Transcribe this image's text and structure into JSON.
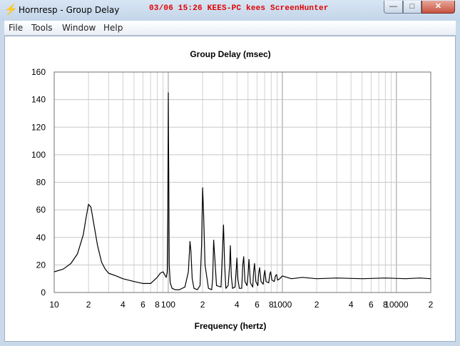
{
  "window": {
    "title": "Hornresp - Group Delay",
    "watermark": "03/06  15:26  KEES-PC  kees  ScreenHunter",
    "app_icon": "lightning-bolt-icon",
    "controls": {
      "minimize": "—",
      "maximize": "□",
      "close": "✕"
    }
  },
  "menu": [
    "File",
    "Tools",
    "Window",
    "Help"
  ],
  "chart_data": {
    "type": "line",
    "title": "Group Delay (msec)",
    "xlabel": "Frequency (hertz)",
    "ylabel": "",
    "xscale": "log",
    "xlim": [
      10,
      20000
    ],
    "ylim": [
      0,
      160
    ],
    "yticks": [
      0,
      20,
      40,
      60,
      80,
      100,
      120,
      140,
      160
    ],
    "xtick_labels": [
      {
        "x": 10,
        "label": "10"
      },
      {
        "x": 20,
        "label": "2"
      },
      {
        "x": 40,
        "label": "4"
      },
      {
        "x": 60,
        "label": "6"
      },
      {
        "x": 80,
        "label": "8"
      },
      {
        "x": 100,
        "label": "100"
      },
      {
        "x": 200,
        "label": "2"
      },
      {
        "x": 400,
        "label": "4"
      },
      {
        "x": 600,
        "label": "6"
      },
      {
        "x": 800,
        "label": "8"
      },
      {
        "x": 1000,
        "label": "1000"
      },
      {
        "x": 2000,
        "label": "2"
      },
      {
        "x": 4000,
        "label": "4"
      },
      {
        "x": 6000,
        "label": "6"
      },
      {
        "x": 8000,
        "label": "8"
      },
      {
        "x": 10000,
        "label": "10000"
      },
      {
        "x": 20000,
        "label": "2"
      }
    ],
    "grid": true,
    "series": [
      {
        "name": "",
        "color": "#000000",
        "x": [
          10,
          12,
          14,
          16,
          18,
          19,
          20,
          21,
          22,
          24,
          26,
          28,
          30,
          35,
          40,
          50,
          60,
          70,
          80,
          85,
          90,
          93,
          96,
          98,
          99,
          100,
          100.5,
          101,
          101.5,
          102,
          104,
          108,
          115,
          125,
          140,
          150,
          155,
          158,
          162,
          168,
          180,
          190,
          196,
          200,
          204,
          210,
          225,
          240,
          245,
          250,
          256,
          265,
          290,
          300,
          305,
          312,
          320,
          335,
          345,
          350,
          357,
          366,
          385,
          395,
          400,
          407,
          420,
          440,
          450,
          458,
          470,
          490,
          500,
          510,
          525,
          550,
          560,
          570,
          585,
          610,
          620,
          632,
          650,
          680,
          690,
          702,
          720,
          760,
          775,
          790,
          810,
          850,
          870,
          890,
          910,
          950,
          1000,
          1200,
          1500,
          2000,
          3000,
          5000,
          8000,
          12000,
          16000,
          20000
        ],
        "y": [
          15,
          17,
          21,
          28,
          42,
          54,
          64,
          62,
          52,
          34,
          22,
          17,
          14,
          12,
          10,
          8,
          6.5,
          6.5,
          11,
          14,
          15,
          13,
          11,
          15,
          60,
          145,
          110,
          90,
          48,
          20,
          7,
          3,
          2,
          2,
          4,
          15,
          37,
          30,
          10,
          3,
          2,
          5,
          35,
          76,
          57,
          20,
          3,
          2,
          10,
          38,
          25,
          5,
          4,
          35,
          49,
          20,
          3,
          5,
          20,
          34,
          12,
          3,
          4,
          18,
          25,
          10,
          3,
          3,
          20,
          26,
          8,
          5,
          13,
          24,
          7,
          4,
          15,
          21,
          8,
          5,
          14,
          18,
          8,
          6,
          12,
          16,
          8,
          7,
          13,
          15,
          9,
          8,
          12,
          13,
          9,
          10,
          12,
          10,
          11,
          10,
          10.5,
          10,
          10.5,
          10,
          10.5,
          10
        ]
      }
    ]
  }
}
